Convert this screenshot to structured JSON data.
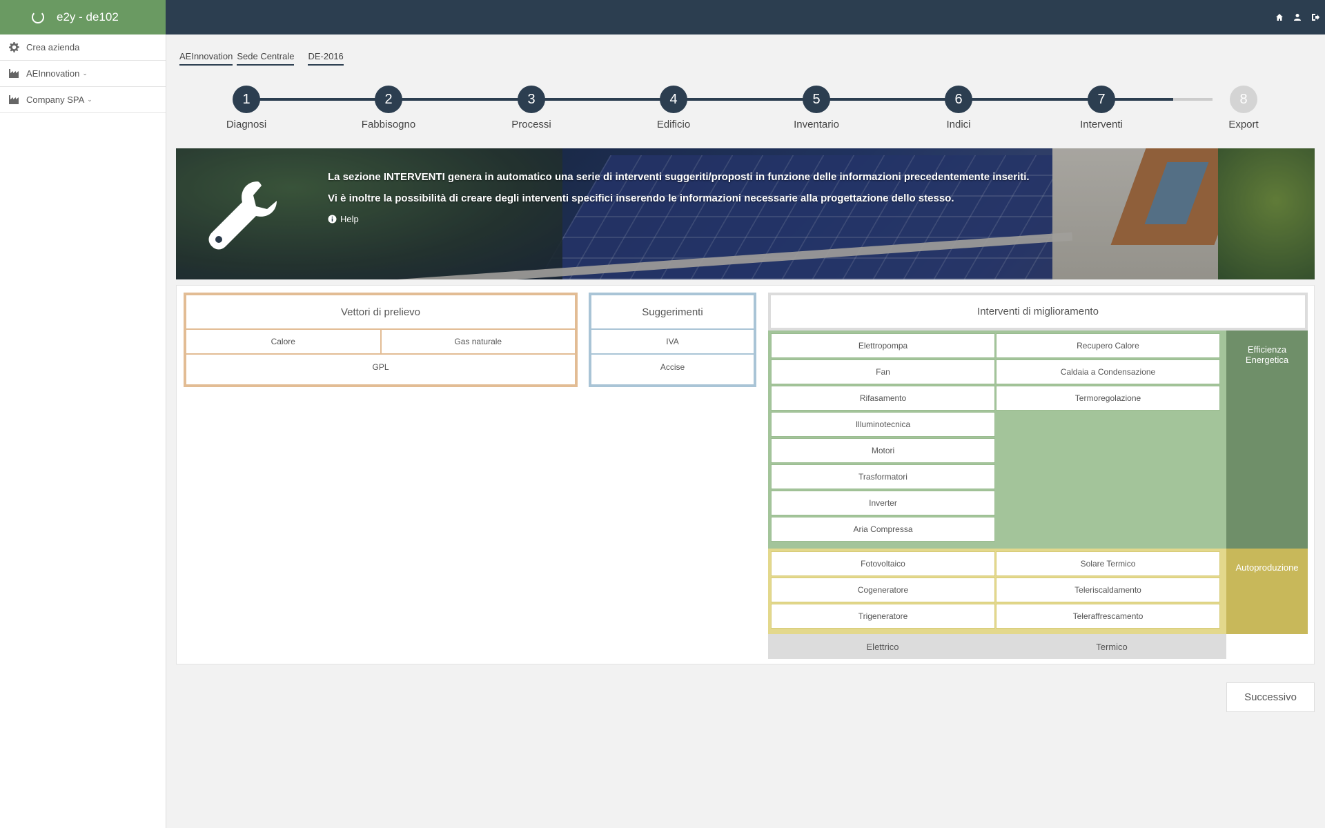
{
  "app": {
    "title": "e2y - de102"
  },
  "sidebar": {
    "items": [
      {
        "label": "Crea azienda",
        "icon": "gear-icon"
      },
      {
        "label": "AEInnovation",
        "icon": "factory-icon"
      },
      {
        "label": "Company SPA",
        "icon": "factory-icon"
      }
    ]
  },
  "breadcrumb": [
    "AEInnovation",
    "Sede Centrale",
    "DE-2016"
  ],
  "steps": [
    {
      "num": "1",
      "label": "Diagnosi"
    },
    {
      "num": "2",
      "label": "Fabbisogno"
    },
    {
      "num": "3",
      "label": "Processi"
    },
    {
      "num": "4",
      "label": "Edificio"
    },
    {
      "num": "5",
      "label": "Inventario"
    },
    {
      "num": "6",
      "label": "Indici"
    },
    {
      "num": "7",
      "label": "Interventi"
    },
    {
      "num": "8",
      "label": "Export"
    }
  ],
  "banner": {
    "line1": "La sezione INTERVENTI genera in automatico una serie di interventi suggeriti/proposti in funzione delle informazioni precedentemente inseriti.",
    "line2": "Vi è inoltre la possibilità di creare degli interventi specifici inserendo le informazioni necessarie alla progettazione dello stesso.",
    "help": "Help"
  },
  "vettori": {
    "title": "Vettori di prelievo",
    "items": [
      "Calore",
      "Gas naturale",
      "GPL"
    ]
  },
  "suggerimenti": {
    "title": "Suggerimenti",
    "items": [
      "IVA",
      "Accise"
    ]
  },
  "interventi": {
    "title": "Interventi di miglioramento",
    "efficienza_label": "Efficienza Energetica",
    "autoproduzione_label": "Autoproduzione",
    "efficienza_elettrico": [
      "Elettropompa",
      "Fan",
      "Rifasamento",
      "Illuminotecnica",
      "Motori",
      "Trasformatori",
      "Inverter",
      "Aria Compressa"
    ],
    "efficienza_termico": [
      "Recupero Calore",
      "Caldaia a Condensazione",
      "Termoregolazione"
    ],
    "auto_elettrico": [
      "Fotovoltaico",
      "Cogeneratore",
      "Trigeneratore"
    ],
    "auto_termico": [
      "Solare Termico",
      "Teleriscaldamento",
      "Teleraffrescamento"
    ],
    "col_elettrico": "Elettrico",
    "col_termico": "Termico"
  },
  "footer": {
    "next_label": "Successivo"
  },
  "colors": {
    "topbar": "#2c3e50",
    "brand": "#6a9a62",
    "vettori_border": "#e2bc94",
    "sugg_border": "#a9c4d6",
    "green": "#a3c49a",
    "green_dark": "#6f8f69",
    "yellow": "#e3d88c",
    "yellow_dark": "#c8b85a"
  }
}
